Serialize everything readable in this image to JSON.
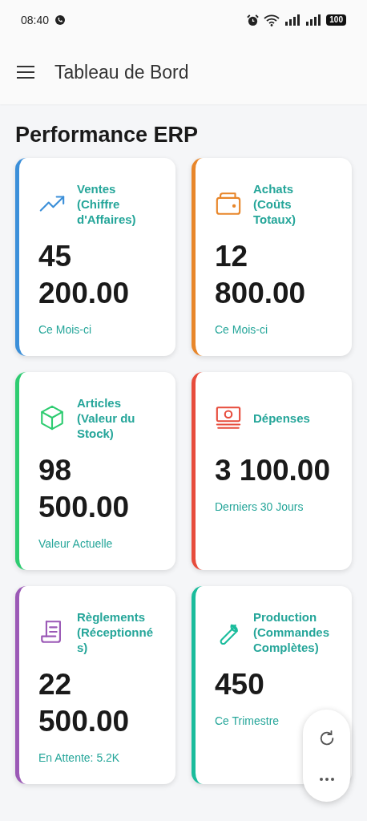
{
  "status_bar": {
    "time": "08:40",
    "battery": "100"
  },
  "app_bar": {
    "title": "Tableau de Bord"
  },
  "section_title": "Performance ERP",
  "cards": [
    {
      "title": "Ventes (Chiffre d'Affaires)",
      "value": "45 200.00",
      "caption": "Ce Mois-ci",
      "color": "#3b8fd9"
    },
    {
      "title": "Achats (Coûts Totaux)",
      "value": "12 800.00",
      "caption": "Ce Mois-ci",
      "color": "#e8862a"
    },
    {
      "title": "Articles (Valeur du Stock)",
      "value": "98 500.00",
      "caption": "Valeur Actuelle",
      "color": "#2ecc71"
    },
    {
      "title": "Dépenses",
      "value": "3 100.00",
      "caption": "Derniers 30 Jours",
      "color": "#e74c3c"
    },
    {
      "title": "Règlements (Réceptionnés)",
      "value": "22 500.00",
      "caption": "En Attente: 5.2K",
      "color": "#9b59b6"
    },
    {
      "title": "Production (Commandes Complètes)",
      "value": "450",
      "caption": "Ce Trimestre",
      "color": "#1abc9c"
    }
  ]
}
